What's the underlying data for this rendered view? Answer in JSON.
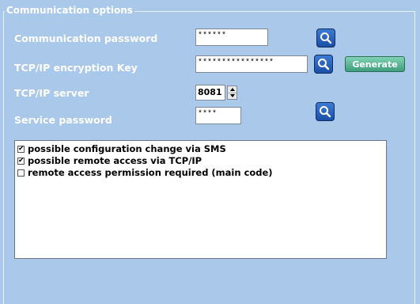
{
  "section": {
    "title": "Communication options"
  },
  "fields": {
    "comm_password": {
      "label": "Communication password",
      "value": "******"
    },
    "encryption_key": {
      "label": "TCP/IP encryption Key",
      "value": "****************"
    },
    "tcp_server": {
      "label": "TCP/IP server",
      "value": "8081"
    },
    "service_password": {
      "label": "Service password",
      "value": "****"
    }
  },
  "buttons": {
    "generate": "Generate"
  },
  "options": [
    {
      "label": "possible configuration change via SMS",
      "checked": true,
      "mark": "✔"
    },
    {
      "label": "possible remote access via TCP/IP",
      "checked": true,
      "mark": "✔"
    },
    {
      "label": "remote access permission required (main code)",
      "checked": false,
      "mark": ""
    }
  ],
  "colors": {
    "background": "#a9c8ea",
    "search_button": "#1a4fa6",
    "generate_button": "#3f9c7d"
  },
  "icons": {
    "search": "magnifier-icon"
  }
}
